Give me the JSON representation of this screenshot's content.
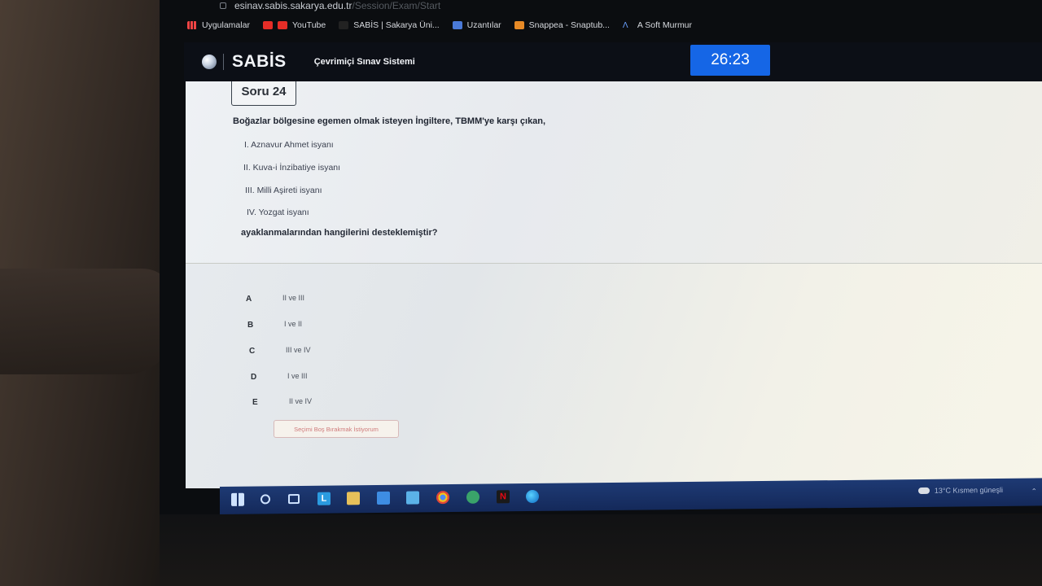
{
  "browser": {
    "url_host": "esinav.sabis.sakarya.edu.tr",
    "url_path": "/Session/Exam/Start",
    "bookmarks": [
      {
        "label": "Uygulamalar",
        "icon": "apps-grid-icon"
      },
      {
        "label": "YouTube",
        "icon": "youtube-icon"
      },
      {
        "label": "SABİS | Sakarya Üni...",
        "icon": "sabis-icon"
      },
      {
        "label": "Uzantılar",
        "icon": "extension-icon"
      },
      {
        "label": "Snappea - Snaptub...",
        "icon": "snappea-icon"
      },
      {
        "label": "A Soft Murmur",
        "icon": "soft-murmur-icon"
      }
    ]
  },
  "header": {
    "logo": "SABİS",
    "subtitle": "Çevrimiçi Sınav Sistemi",
    "timer": "26:23",
    "accent": "#1566e6"
  },
  "question": {
    "tab_label": "Soru 24",
    "stem": "Boğazlar bölgesine egemen olmak isteyen İngiltere, TBMM'ye karşı çıkan,",
    "items": [
      "I. Aznavur Ahmet isyanı",
      "II. Kuva-i İnzibatiye isyanı",
      "III. Milli Aşireti isyanı",
      "IV. Yozgat isyanı"
    ],
    "ending": "ayaklanmalarından hangilerini desteklemiştir?"
  },
  "options": [
    {
      "letter": "A",
      "text": "II ve III"
    },
    {
      "letter": "B",
      "text": "I ve II"
    },
    {
      "letter": "C",
      "text": "III ve IV"
    },
    {
      "letter": "D",
      "text": "I ve III"
    },
    {
      "letter": "E",
      "text": "II ve IV"
    }
  ],
  "blank_button": "Seçimi Boş Bırakmak İstiyorum",
  "taskbar": {
    "weather": "13°C  Kısmen güneşli",
    "apps": [
      "windows-start-icon",
      "search-icon",
      "task-view-icon",
      "l-app-icon",
      "file-explorer-icon",
      "mail-icon",
      "store-icon",
      "chrome-icon",
      "app-icon",
      "netflix-icon",
      "edge-icon"
    ]
  }
}
